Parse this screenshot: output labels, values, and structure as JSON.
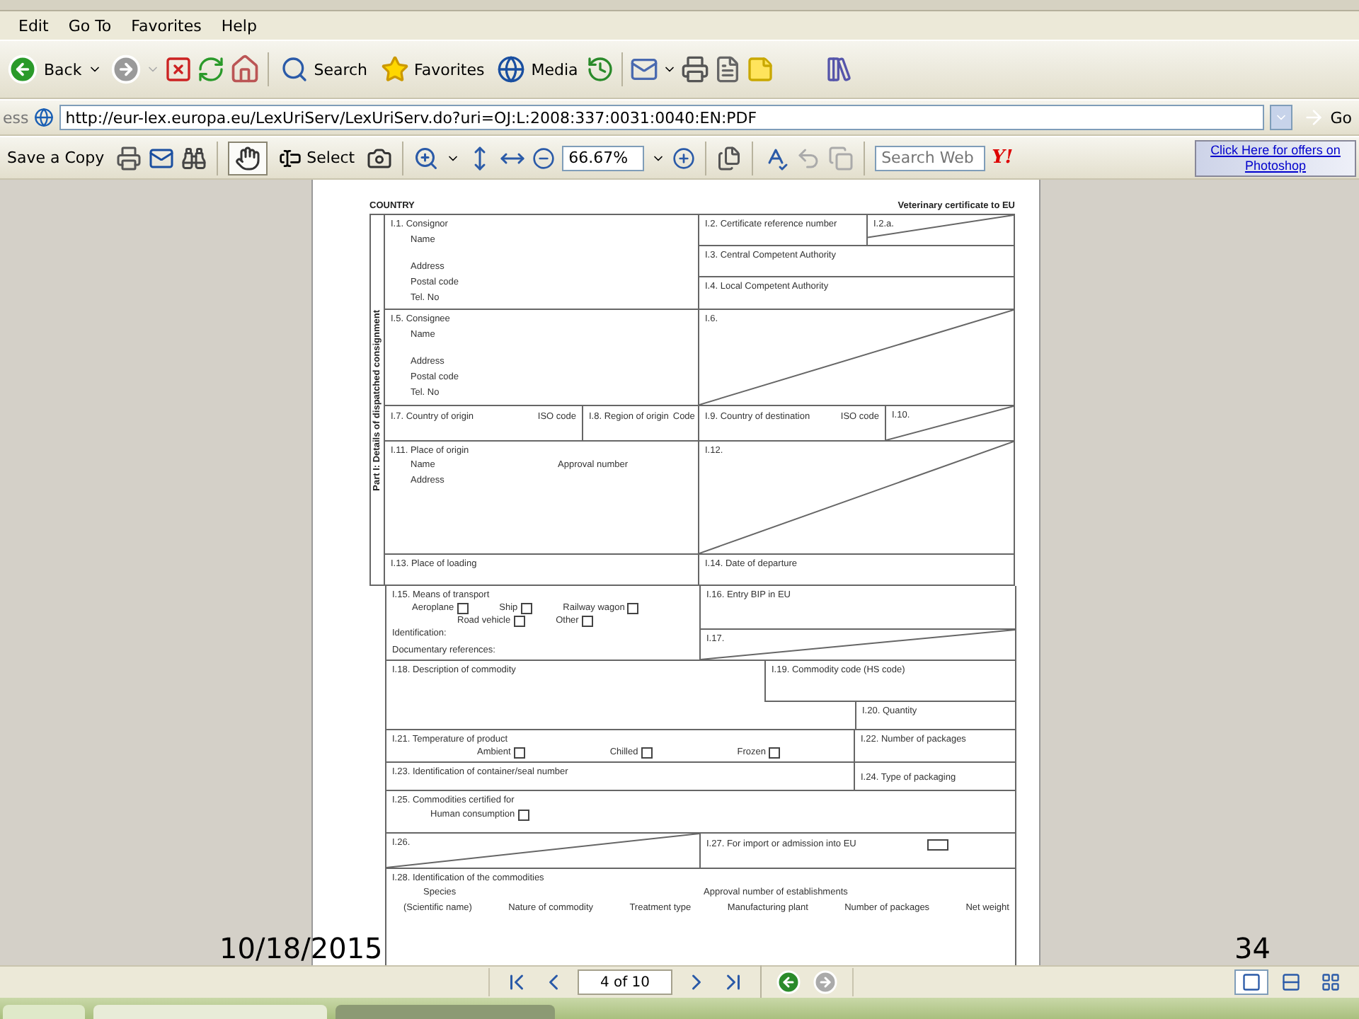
{
  "menu": [
    "Edit",
    "Go To",
    "Favorites",
    "Help"
  ],
  "browser_toolbar": {
    "back": "Back",
    "search": "Search",
    "favorites": "Favorites",
    "media": "Media"
  },
  "address_bar": {
    "label": "ess",
    "url": "http://eur-lex.europa.eu/LexUriServ/LexUriServ.do?uri=OJ:L:2008:337:0031:0040:EN:PDF",
    "go": "Go"
  },
  "pdf_toolbar": {
    "save": "Save a Copy",
    "hand_pressed": true,
    "select": "Select",
    "zoom": "66.67%",
    "search_placeholder": "Search Web",
    "yahoo": "Y!",
    "ad": "Click Here for offers on Photoshop"
  },
  "document": {
    "country": "COUNTRY",
    "certificate": "Veterinary certificate to EU",
    "side_label": "Part I: Details of dispatched consignment",
    "consignor": {
      "title": "I.1. Consignor",
      "fields": [
        "Name",
        "Address",
        "Postal code",
        "Tel. No"
      ]
    },
    "cert_ref": "I.2. Certificate reference number",
    "cert_ref_a": "I.2.a.",
    "central_authority": "I.3. Central Competent Authority",
    "local_authority": "I.4. Local Competent Authority",
    "consignee": {
      "title": "I.5. Consignee",
      "fields": [
        "Name",
        "Address",
        "Postal code",
        "Tel. No"
      ]
    },
    "box_6": "I.6.",
    "origin": {
      "title": "I.7. Country of origin",
      "code": "ISO code"
    },
    "region": {
      "title": "I.8. Region of origin",
      "code": "Code"
    },
    "destination": {
      "title": "I.9. Country of destination",
      "code": "ISO code"
    },
    "box_10": "I.10.",
    "place_of_origin": {
      "title": "I.11. Place of origin",
      "name": "Name",
      "approval": "Approval number",
      "address": "Address"
    },
    "box_12": "I.12.",
    "loading": "I.13. Place of loading",
    "departure": "I.14. Date of departure",
    "transport": {
      "title": "I.15. Means of transport",
      "options_row_1": [
        {
          "label": "Aeroplane",
          "checked": false
        },
        {
          "label": "Ship",
          "checked": false
        },
        {
          "label": "Railway wagon",
          "checked": false
        }
      ],
      "options_row_2": [
        {
          "label": "Road vehicle",
          "checked": false
        },
        {
          "label": "Other",
          "checked": false
        }
      ],
      "identification": "Identification:",
      "references": "Documentary references:"
    },
    "entry_bip": "I.16. Entry BIP in EU",
    "box_17": "I.17.",
    "description": "I.18. Description of commodity",
    "commodity_code": "I.19. Commodity code (HS code)",
    "quantity": "I.20. Quantity",
    "temperature": {
      "title": "I.21. Temperature of product",
      "options": [
        {
          "label": "Ambient",
          "checked": false
        },
        {
          "label": "Chilled",
          "checked": false
        },
        {
          "label": "Frozen",
          "checked": false
        }
      ]
    },
    "packages": "I.22. Number of packages",
    "container": "I.23. Identification of container/seal number",
    "packaging": "I.24. Type of packaging",
    "certified": {
      "title": "I.25. Commodities certified for",
      "option": {
        "label": "Human consumption",
        "checked": false
      }
    },
    "box_26": "I.26.",
    "import": {
      "title": "I.27. For import or admission into EU",
      "checked": false
    },
    "commodities": {
      "title": "I.28. Identification of the commodities",
      "species": "Species",
      "approval": "Approval number of establishments",
      "columns": [
        "(Scientific name)",
        "Nature of commodity",
        "Treatment type",
        "Manufacturing plant",
        "Number of packages",
        "Net weight"
      ]
    }
  },
  "slide_footer": {
    "date": "10/18/2015",
    "number": "34"
  },
  "page_nav": {
    "page": "4 of 10",
    "views": [
      {
        "selected": true
      },
      {
        "selected": false
      },
      {
        "selected": false
      }
    ]
  }
}
